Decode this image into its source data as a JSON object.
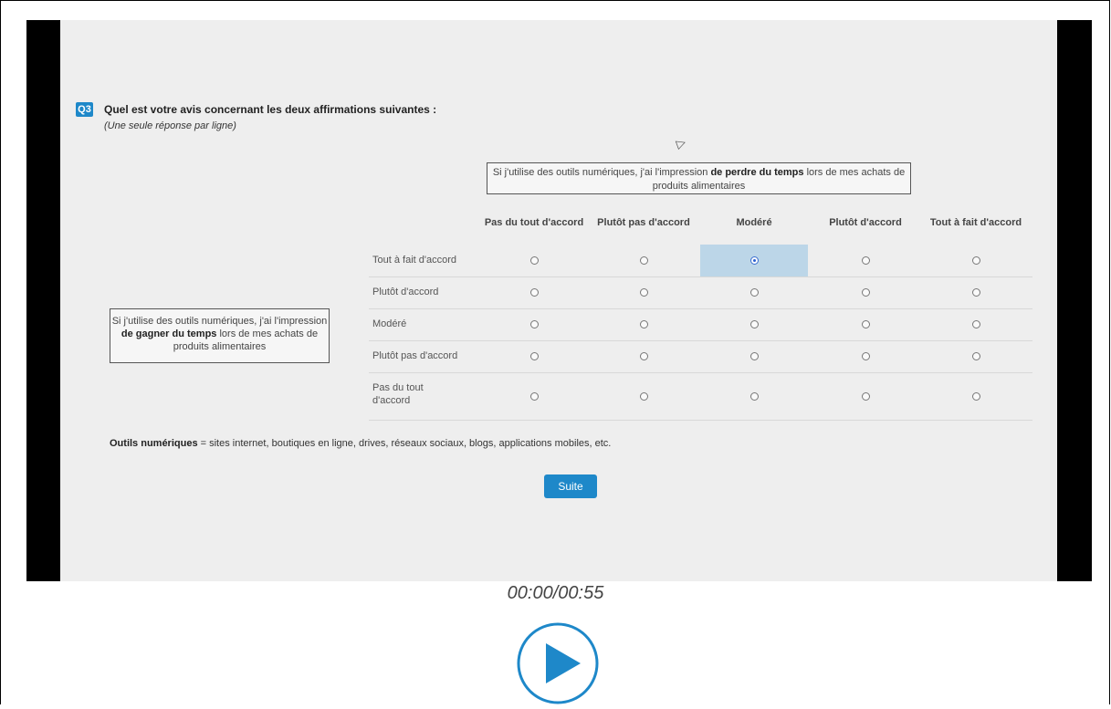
{
  "question": {
    "badge": "Q3",
    "title": "Quel est votre avis concernant les deux affirmations suivantes :",
    "subtitle": "(Une seule réponse par ligne)"
  },
  "top_statement": {
    "pre": "Si j'utilise des outils numériques, j'ai l'impression ",
    "bold": "de perdre du temps",
    "post": " lors de mes achats de produits alimentaires"
  },
  "left_statement": {
    "pre": "Si j'utilise des outils numériques, j'ai l'impression ",
    "bold": "de gagner du temps",
    "post": " lors de mes achats de produits alimentaires"
  },
  "columns": [
    "Pas du tout d'accord",
    "Plutôt pas d'accord",
    "Modéré",
    "Plutôt d'accord",
    "Tout à fait d'accord"
  ],
  "rows": [
    {
      "label": "Tout à fait d'accord",
      "selected": 2
    },
    {
      "label": "Plutôt d'accord",
      "selected": -1
    },
    {
      "label": "Modéré",
      "selected": -1
    },
    {
      "label": "Plutôt pas d'accord",
      "selected": -1
    },
    {
      "label": "Pas du tout d'accord",
      "selected": -1
    }
  ],
  "footnote": {
    "bold": "Outils numériques",
    "rest": " = sites internet, boutiques en ligne, drives, réseaux sociaux, blogs, applications mobiles, etc."
  },
  "suite_label": "Suite",
  "player": {
    "time": "00:00/00:55",
    "play_icon": "play-icon",
    "accent": "#1e88c9"
  }
}
